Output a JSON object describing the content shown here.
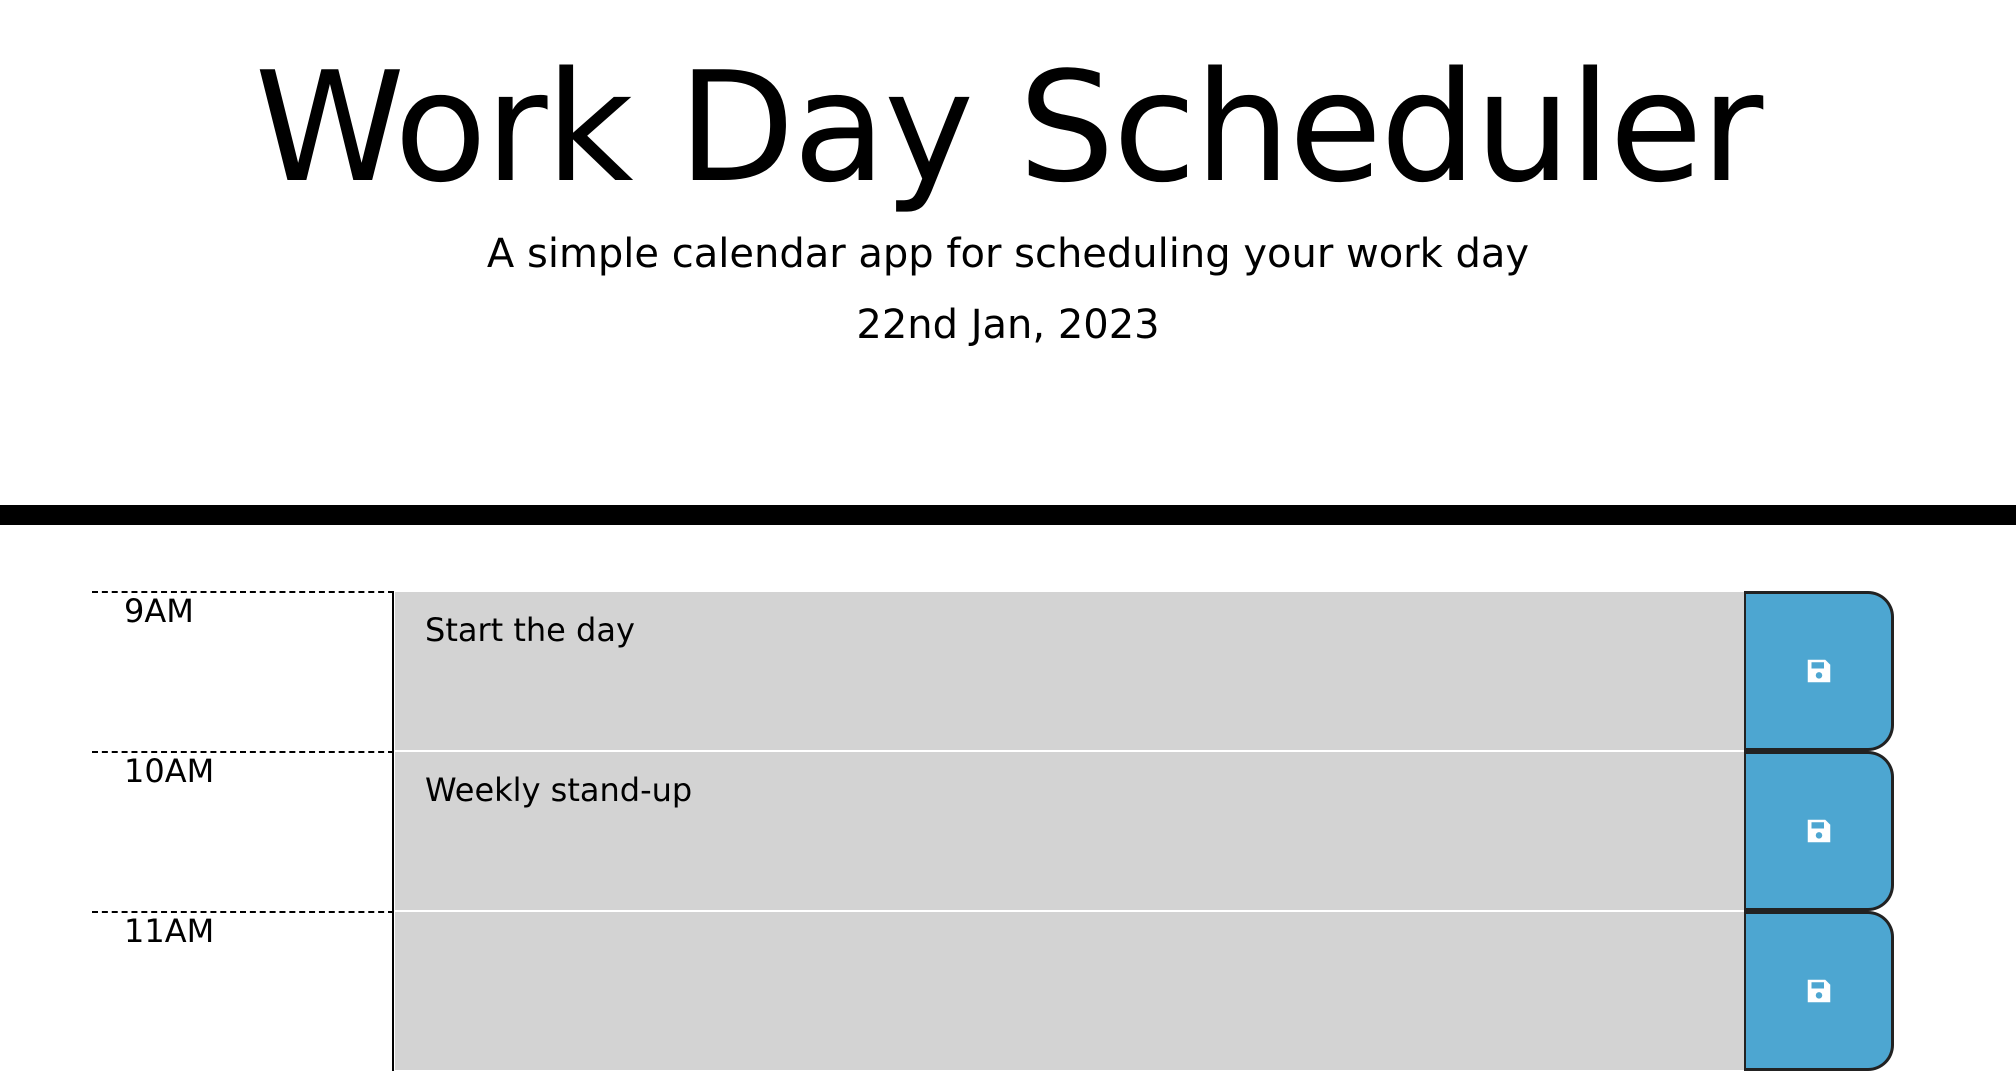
{
  "header": {
    "title": "Work Day Scheduler",
    "subtitle": "A simple calendar app for scheduling your work day",
    "current_date": "22nd Jan, 2023"
  },
  "schedule": {
    "rows": [
      {
        "hour": "9AM",
        "event": "Start the day",
        "save_icon": "save-icon"
      },
      {
        "hour": "10AM",
        "event": "Weekly stand-up",
        "save_icon": "save-icon"
      },
      {
        "hour": "11AM",
        "event": "",
        "save_icon": "save-icon"
      }
    ]
  },
  "colors": {
    "event_background": "#d3d3d3",
    "save_button": "#4da6d1",
    "divider": "#000000"
  }
}
